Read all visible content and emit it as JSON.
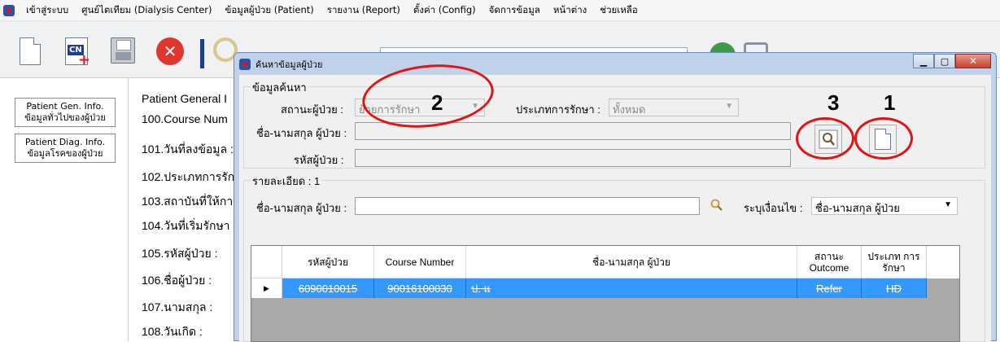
{
  "menubar": {
    "items": [
      "เข้าสู่ระบบ",
      "ศูนย์ไตเทียม (Dialysis Center)",
      "ข้อมูลผู้ป่วย (Patient)",
      "รายงาน (Report)",
      "ตั้งค่า (Config)",
      "จัดการข้อมูล",
      "หน้าต่าง",
      "ช่วยเหลือ"
    ]
  },
  "sidebar": {
    "buttons": [
      {
        "line1": "Patient Gen. Info.",
        "line2": "ข้อมูลทั่วไปของผู้ป่วย"
      },
      {
        "line1": "Patient Diag. Info.",
        "line2": "ข้อมูลโรคของผู้ป่วย"
      }
    ]
  },
  "background": {
    "heading": "Patient General I",
    "rows": [
      "100.Course Num",
      "101.วันที่ลงข้อมูล :",
      "102.ประเภทการรัก",
      "103.สถาบันที่ให้การ",
      "104.วันที่เริ่มรักษา",
      "105.รหัสผู้ป่วย :",
      "106.ชื่อผู้ป่วย :",
      "107.นามสกุล :",
      "108.วันเกิด :"
    ]
  },
  "dialog": {
    "title": "ค้นหาข้อมูลผู้ป่วย",
    "search_group": {
      "title": "ข้อมูลค้นหา",
      "status_label": "สถานะผู้ป่วย :",
      "status_value": "ย้ายการรักษา",
      "treatment_label": "ประเภทการรักษา :",
      "treatment_value": "ทั้งหมด",
      "name_label": "ชื่อ-นามสกุล ผู้ป่วย :",
      "id_label": "รหัสผู้ป่วย :"
    },
    "detail_group": {
      "title": "รายละเอียด : 1",
      "name_label": "ชื่อ-นามสกุล ผู้ป่วย :",
      "condition_label": "ระบุเงื่อนไข :",
      "condition_value": "ชื่อ-นามสกุล ผู้ป่วย"
    },
    "grid": {
      "headers": [
        "รหัสผู้ป่วย",
        "Course Number",
        "ชื่อ-นามสกุล ผู้ป่วย",
        "สถานะ Outcome",
        "ประเภท การรักษา"
      ],
      "rows": [
        {
          "id": "6090010015",
          "course": "90016100030",
          "name": "ป. แ",
          "outcome": "Refer",
          "type": "HD"
        }
      ]
    }
  },
  "annotations": {
    "label1": "1",
    "label2": "2",
    "label3": "3"
  },
  "colors": {
    "selection": "#3399ff",
    "annotation_ring": "#e11414",
    "dialog_frame": "#bfd2ea"
  }
}
